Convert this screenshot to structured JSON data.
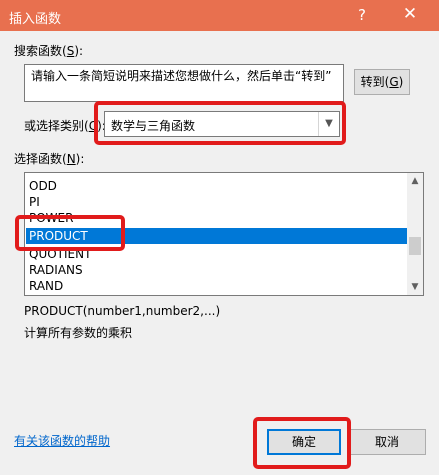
{
  "dialog": {
    "title": "插入函数",
    "help_glyph": "?",
    "close_glyph": "✕"
  },
  "search": {
    "label_pre": "搜索函数(",
    "label_key": "S",
    "label_post": "):",
    "value": "请输入一条简短说明来描述您想做什么，然后单击“转到”",
    "goto_pre": "转到(",
    "goto_key": "G",
    "goto_post": ")"
  },
  "category": {
    "label_pre": "或选择类别(",
    "label_key": "C",
    "label_post": "):",
    "selected": "数学与三角函数"
  },
  "function_list": {
    "label_pre": "选择函数(",
    "label_key": "N",
    "label_post": "):",
    "items": [
      "ODD",
      "PI",
      "POWER",
      "PRODUCT",
      "QUOTIENT",
      "RADIANS",
      "RAND"
    ],
    "selected_index": 3
  },
  "description": {
    "signature": "PRODUCT(number1,number2,...)",
    "text": "计算所有参数的乘积"
  },
  "footer": {
    "help_link": "有关该函数的帮助",
    "ok": "确定",
    "cancel": "取消"
  },
  "colors": {
    "titlebar": "#e8704f",
    "selection": "#0078d7",
    "annotation": "#e11b1b"
  }
}
